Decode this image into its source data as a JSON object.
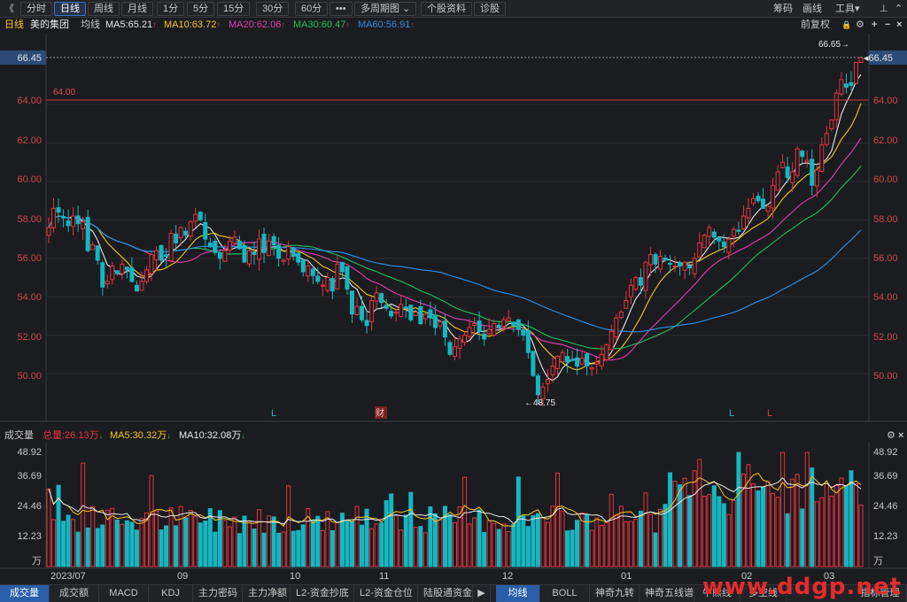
{
  "toolbar": {
    "back": "《",
    "buttons": [
      {
        "label": "分时",
        "key": "fenshi"
      },
      {
        "label": "日线",
        "key": "rixian",
        "active": true
      },
      {
        "label": "周线",
        "key": "zhouxian"
      },
      {
        "label": "月线",
        "key": "yuexian"
      },
      {
        "label": "1分",
        "key": "1fen"
      },
      {
        "label": "5分",
        "key": "5fen"
      },
      {
        "label": "15分",
        "key": "15fen"
      },
      {
        "label": "30分",
        "key": "30fen"
      },
      {
        "label": "60分",
        "key": "60fen"
      },
      {
        "label": "•••",
        "key": "more"
      },
      {
        "label": "多周期图 ⌄",
        "key": "multi-period"
      },
      {
        "label": "个股资料",
        "key": "stock-info"
      },
      {
        "label": "诊股",
        "key": "diagnose"
      }
    ],
    "right": {
      "chouma": "筹码",
      "huaxian": "画线",
      "gongju": "工具▾",
      "pin": "⊥",
      "chevron_up": "⌃"
    }
  },
  "ma_bar": {
    "period": "日线",
    "stock": "美的集团",
    "junxian": "均线",
    "items": [
      {
        "label": "MA5:65.21",
        "color": "#e8e8e8"
      },
      {
        "label": "MA10:63.72",
        "color": "#f3c623"
      },
      {
        "label": "MA20:62.06",
        "color": "#e040b0"
      },
      {
        "label": "MA30:60.47",
        "color": "#22c05a"
      },
      {
        "label": "MA60:56.91",
        "color": "#2f8fe6"
      }
    ],
    "up_arrow": "↑",
    "right": {
      "fuquan": "前复权",
      "lock": "🔒",
      "settings": "⚙",
      "zoom_in": "+",
      "zoom_out": "−",
      "close": "×"
    }
  },
  "price_axis": {
    "left_ticks": [
      "66.45",
      "64.00",
      "62.00",
      "60.00",
      "58.00",
      "56.00",
      "54.00",
      "52.00",
      "50.00"
    ],
    "right_ticks": [
      "66.45",
      "64.00",
      "62.00",
      "60.00",
      "58.00",
      "56.00",
      "54.00",
      "52.00",
      "50.00"
    ],
    "hline_label": "64.00",
    "high_label": "66.65→",
    "low_label": "←48.75",
    "current_label": "◂66.45",
    "markers": [
      "L",
      "财",
      "L",
      "L"
    ]
  },
  "volume_bar": {
    "title": "成交量",
    "total": "总量:26.13万",
    "ma5": "MA5:30.32万",
    "ma10": "MA10:32.08万",
    "ticks": [
      "48.92",
      "36.69",
      "24.46",
      "12.23",
      "万"
    ],
    "down_arrow": "↓",
    "settings": "⚙",
    "close": "×"
  },
  "date_axis": [
    "2023/07",
    "09",
    "10",
    "11",
    "12",
    "01",
    "02",
    "03"
  ],
  "tabs_left": [
    "成交量",
    "成交额",
    "MACD",
    "KDJ",
    "主力密码",
    "主力净额",
    "L2-资金抄底",
    "L2-资金仓位",
    "陆股通资金"
  ],
  "tab_arrow": "▶",
  "tabs_right": [
    "均线",
    "BOLL",
    "神奇九转",
    "神奇五线谱",
    "牛熊线",
    "多空线",
    "指标管理"
  ],
  "watermark": "www.ddgp.net",
  "colors": {
    "up": "#e6333b",
    "down": "#14b7c2",
    "bg": "#1b1c20"
  },
  "chart_data": {
    "type": "candlestick",
    "price_range": [
      48.2,
      67.2
    ],
    "hline": 64.0,
    "current": 66.45,
    "high": 66.65,
    "low": 48.75,
    "close_series": [
      57.6,
      58.6,
      58.4,
      58.1,
      57.7,
      58.2,
      57.8,
      57.9,
      56.4,
      56.7,
      55.9,
      54.5,
      54.8,
      55.6,
      55.2,
      55.7,
      55.4,
      54.8,
      54.3,
      54.8,
      55.4,
      56.2,
      56.4,
      55.9,
      56.1,
      57.3,
      56.8,
      57.6,
      57.2,
      57.9,
      58.3,
      58.0,
      57.0,
      56.6,
      56.3,
      56.0,
      56.4,
      56.9,
      57.1,
      56.5,
      55.8,
      56.4,
      56.2,
      57.0,
      56.3,
      56.9,
      56.7,
      56.0,
      55.9,
      56.6,
      56.1,
      55.8,
      55.3,
      55.6,
      55.1,
      54.8,
      54.6,
      55.0,
      54.3,
      55.7,
      55.3,
      54.4,
      53.1,
      53.5,
      52.8,
      52.5,
      53.8,
      54.2,
      53.7,
      53.4,
      53.0,
      53.2,
      53.6,
      53.4,
      52.8,
      53.2,
      52.6,
      53.1,
      52.9,
      52.4,
      52.7,
      51.9,
      51.0,
      51.4,
      51.8,
      52.0,
      52.4,
      52.6,
      52.2,
      51.8,
      52.3,
      52.6,
      52.4,
      52.8,
      52.9,
      52.5,
      52.3,
      52.0,
      51.1,
      49.9,
      48.9,
      49.3,
      49.7,
      50.4,
      50.9,
      51.1,
      50.6,
      50.7,
      50.4,
      50.8,
      50.4,
      50.3,
      50.6,
      51.0,
      51.5,
      52.2,
      52.9,
      53.2,
      53.8,
      54.6,
      55.0,
      54.6,
      55.8,
      56.2,
      55.7,
      56.1,
      55.9,
      55.7,
      55.6,
      55.6,
      55.8,
      55.5,
      56.0,
      56.8,
      57.2,
      57.6,
      57.1,
      56.9,
      56.6,
      57.0,
      57.5,
      57.4,
      58.2,
      58.6,
      59.1,
      59.0,
      58.6,
      58.7,
      59.8,
      60.5,
      61.0,
      60.2,
      60.5,
      61.7,
      61.3,
      61.1,
      59.8,
      60.6,
      61.9,
      62.5,
      63.2,
      64.6,
      65.3,
      64.9,
      65.0,
      66.2,
      66.45
    ],
    "volume_range": [
      0,
      48.92
    ]
  }
}
